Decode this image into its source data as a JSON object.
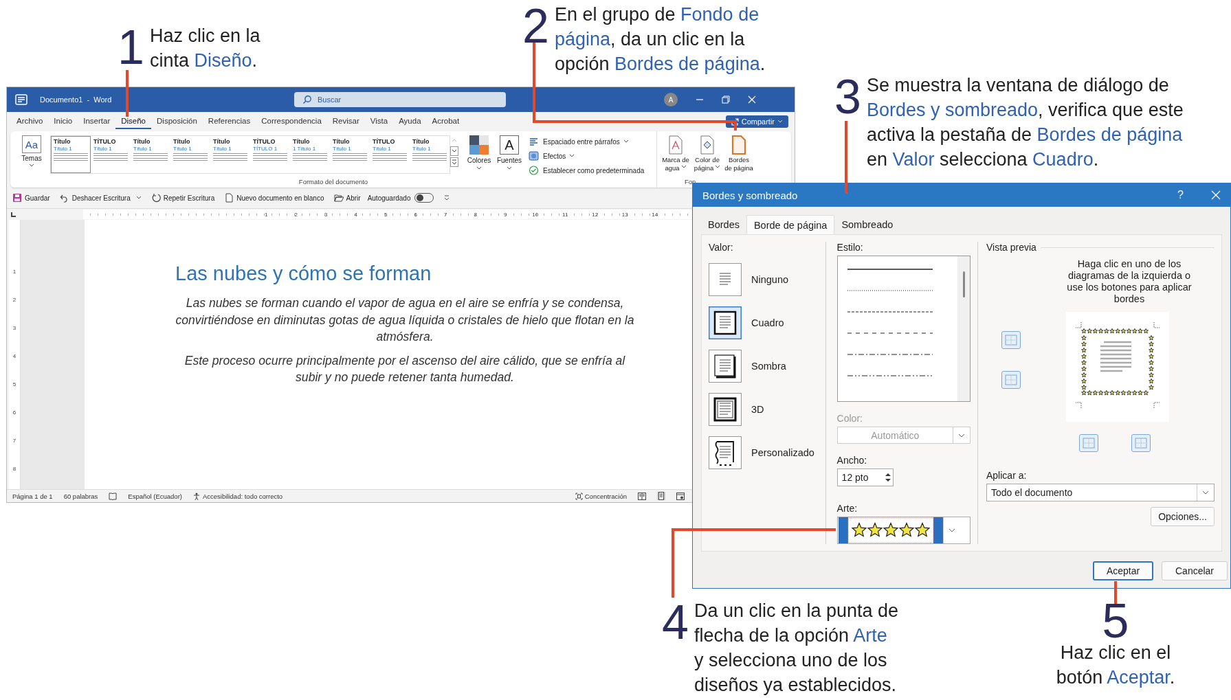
{
  "annotations": [
    {
      "number": "1",
      "lines": [
        [
          {
            "text": "Haz clic en la",
            "highlight": false
          }
        ],
        [
          {
            "text": "cinta ",
            "highlight": false
          },
          {
            "text": "Diseño",
            "highlight": true
          },
          {
            "text": ".",
            "highlight": false
          }
        ]
      ]
    },
    {
      "number": "2",
      "lines": [
        [
          {
            "text": "En el grupo de ",
            "highlight": false
          },
          {
            "text": "Fondo de",
            "highlight": true
          }
        ],
        [
          {
            "text": "página",
            "highlight": true
          },
          {
            "text": ", da un clic en la",
            "highlight": false
          }
        ],
        [
          {
            "text": "opción ",
            "highlight": false
          },
          {
            "text": "Bordes de página",
            "highlight": true
          },
          {
            "text": ".",
            "highlight": false
          }
        ]
      ]
    },
    {
      "number": "3",
      "lines": [
        [
          {
            "text": "Se muestra la ventana de diálogo de",
            "highlight": false
          }
        ],
        [
          {
            "text": "Bordes y sombreado",
            "highlight": true
          },
          {
            "text": ", verifica que este",
            "highlight": false
          }
        ],
        [
          {
            "text": "activa la pestaña de ",
            "highlight": false
          },
          {
            "text": "Bordes de página",
            "highlight": true
          }
        ],
        [
          {
            "text": "en ",
            "highlight": false
          },
          {
            "text": "Valor",
            "highlight": true
          },
          {
            "text": " selecciona ",
            "highlight": false
          },
          {
            "text": "Cuadro",
            "highlight": true
          },
          {
            "text": ".",
            "highlight": false
          }
        ]
      ]
    },
    {
      "number": "4",
      "lines": [
        [
          {
            "text": "Da un clic en la punta de",
            "highlight": false
          }
        ],
        [
          {
            "text": "flecha de la opción ",
            "highlight": false
          },
          {
            "text": "Arte",
            "highlight": true
          }
        ],
        [
          {
            "text": "y selecciona uno de los",
            "highlight": false
          }
        ],
        [
          {
            "text": "diseños ya establecidos.",
            "highlight": false
          }
        ]
      ]
    },
    {
      "number": "5",
      "lines": [
        [
          {
            "text": "Haz clic en el",
            "highlight": false
          }
        ],
        [
          {
            "text": "botón ",
            "highlight": false
          },
          {
            "text": "Aceptar",
            "highlight": true
          },
          {
            "text": ".",
            "highlight": false
          }
        ]
      ]
    }
  ],
  "word": {
    "title": "Documento1  -  Word",
    "search": {
      "placeholder": "Buscar"
    },
    "avatar": "A",
    "menu_tabs": [
      {
        "label": "Archivo",
        "selected": false
      },
      {
        "label": "Inicio",
        "selected": false
      },
      {
        "label": "Insertar",
        "selected": false
      },
      {
        "label": "Diseño",
        "selected": true
      },
      {
        "label": "Disposición",
        "selected": false
      },
      {
        "label": "Referencias",
        "selected": false
      },
      {
        "label": "Correspondencia",
        "selected": false
      },
      {
        "label": "Revisar",
        "selected": false
      },
      {
        "label": "Vista",
        "selected": false
      },
      {
        "label": "Ayuda",
        "selected": false
      },
      {
        "label": "Acrobat",
        "selected": false
      }
    ],
    "share_button": "Compartir",
    "ribbon": {
      "themes": {
        "glyph": "Aa",
        "label": "Temas"
      },
      "style_gallery": [
        {
          "title": "Título",
          "subtitle": "Título 1",
          "selected": true
        },
        {
          "title": "TÍTULO",
          "subtitle": "Título 1",
          "selected": false
        },
        {
          "title": "Título",
          "subtitle": "Título 1",
          "selected": false
        },
        {
          "title": "Título",
          "subtitle": "Título 1",
          "selected": false
        },
        {
          "title": "Título",
          "subtitle": "Título 1",
          "selected": false
        },
        {
          "title": "TÍTULO",
          "subtitle": "TÍTULO 1",
          "selected": false
        },
        {
          "title": "Título",
          "subtitle": "1  Título 1",
          "selected": false
        },
        {
          "title": "Título",
          "subtitle": "Título 1",
          "selected": false
        },
        {
          "title": "TÍTULO",
          "subtitle": "Título 1",
          "selected": false
        },
        {
          "title": "Título",
          "subtitle": "Título 1",
          "selected": false
        }
      ],
      "colors": "Colores",
      "fonts": {
        "glyph": "A",
        "label": "Fuentes"
      },
      "paragraph_options": [
        {
          "label": "Espaciado entre párrafos",
          "kind": "spacing"
        },
        {
          "label": "Efectos",
          "kind": "effects"
        },
        {
          "label": "Establecer como predeterminada",
          "kind": "default"
        }
      ],
      "group_label": "Formato del documento",
      "page_background": [
        {
          "lines": [
            "Marca de",
            "agua"
          ],
          "kind": "watermark",
          "dropdown": true
        },
        {
          "lines": [
            "Color de",
            "página"
          ],
          "kind": "color",
          "dropdown": true
        },
        {
          "lines": [
            "Bordes",
            "de página"
          ],
          "kind": "borders",
          "dropdown": false
        }
      ],
      "page_background_label": "Fon"
    },
    "quick_access": [
      {
        "label": "Guardar",
        "kind": "save"
      },
      {
        "label": "Deshacer Escritura",
        "kind": "undo"
      },
      {
        "label": "Repetir Escritura",
        "kind": "redo"
      },
      {
        "label": "Nuevo documento en blanco",
        "kind": "new"
      },
      {
        "label": "Abrir",
        "kind": "open"
      }
    ],
    "autosave": {
      "label": "Autoguardado",
      "on": false
    },
    "ruler": {
      "horizontal": [
        "1",
        "2",
        "3",
        "4",
        "5",
        "6",
        "7",
        "8",
        "9",
        "10",
        "11",
        "12",
        "13",
        "14"
      ],
      "vertical": [
        "1",
        "2",
        "3",
        "4",
        "5",
        "6",
        "7",
        "8"
      ]
    },
    "document": {
      "heading": "Las nubes y cómo se forman",
      "paragraphs": [
        "Las nubes se forman cuando el vapor de agua en el aire se enfría y se condensa, convirtiéndose en diminutas gotas de agua líquida o cristales de hielo que flotan en la atmósfera.",
        "Este proceso ocurre principalmente por el ascenso del aire cálido, que se enfría al subir y no puede retener tanta humedad."
      ]
    },
    "status_bar": {
      "page": "Página 1 de 1",
      "words": "60 palabras",
      "language": "Español (Ecuador)",
      "accessibility": "Accesibilidad: todo correcto",
      "focus": "Concentración"
    }
  },
  "dialog": {
    "title": "Bordes y sombreado",
    "help": "?",
    "tabs": [
      {
        "label": "Bordes",
        "selected": false
      },
      {
        "label": "Borde de página",
        "selected": true
      },
      {
        "label": "Sombreado",
        "selected": false
      }
    ],
    "setting": {
      "label": "Valor:",
      "options": [
        {
          "label": "Ninguno",
          "kind": "none",
          "selected": false
        },
        {
          "label": "Cuadro",
          "kind": "box",
          "selected": true
        },
        {
          "label": "Sombra",
          "kind": "shadow",
          "selected": false
        },
        {
          "label": "3D",
          "kind": "raised",
          "selected": false
        },
        {
          "label": "Personalizado",
          "kind": "custom",
          "selected": false
        }
      ]
    },
    "style": {
      "label": "Estilo:",
      "lines": [
        {
          "kind": "solid"
        },
        {
          "kind": "dotted"
        },
        {
          "kind": "dashed"
        },
        {
          "kind": "wide-dashed"
        },
        {
          "kind": "dash-dot"
        },
        {
          "kind": "dash-dot-dot"
        }
      ]
    },
    "color": {
      "label": "Color:",
      "value": "Automático",
      "disabled": true
    },
    "width": {
      "label": "Ancho:",
      "value": "12 pto"
    },
    "art": {
      "label": "Arte:"
    },
    "preview": {
      "label": "Vista previa",
      "hint": "Haga clic en uno de los diagramas de la izquierda o use los botones para aplicar bordes"
    },
    "apply_to": {
      "label": "Aplicar a:",
      "value": "Todo el documento"
    },
    "options_button": "Opciones...",
    "buttons": [
      {
        "label": "Aceptar",
        "default": true
      },
      {
        "label": "Cancelar",
        "default": false
      }
    ]
  }
}
